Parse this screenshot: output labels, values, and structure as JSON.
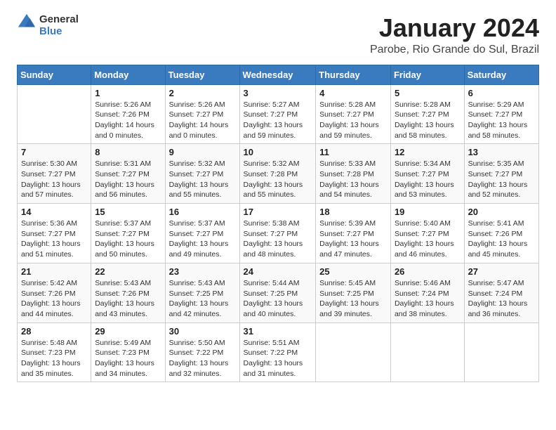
{
  "header": {
    "logo_general": "General",
    "logo_blue": "Blue",
    "main_title": "January 2024",
    "subtitle": "Parobe, Rio Grande do Sul, Brazil"
  },
  "days_of_week": [
    "Sunday",
    "Monday",
    "Tuesday",
    "Wednesday",
    "Thursday",
    "Friday",
    "Saturday"
  ],
  "weeks": [
    [
      {
        "day": "",
        "sunrise": "",
        "sunset": "",
        "daylight": ""
      },
      {
        "day": "1",
        "sunrise": "5:26 AM",
        "sunset": "7:26 PM",
        "daylight": "14 hours and 0 minutes."
      },
      {
        "day": "2",
        "sunrise": "5:26 AM",
        "sunset": "7:27 PM",
        "daylight": "14 hours and 0 minutes."
      },
      {
        "day": "3",
        "sunrise": "5:27 AM",
        "sunset": "7:27 PM",
        "daylight": "13 hours and 59 minutes."
      },
      {
        "day": "4",
        "sunrise": "5:28 AM",
        "sunset": "7:27 PM",
        "daylight": "13 hours and 59 minutes."
      },
      {
        "day": "5",
        "sunrise": "5:28 AM",
        "sunset": "7:27 PM",
        "daylight": "13 hours and 58 minutes."
      },
      {
        "day": "6",
        "sunrise": "5:29 AM",
        "sunset": "7:27 PM",
        "daylight": "13 hours and 58 minutes."
      }
    ],
    [
      {
        "day": "7",
        "sunrise": "5:30 AM",
        "sunset": "7:27 PM",
        "daylight": "13 hours and 57 minutes."
      },
      {
        "day": "8",
        "sunrise": "5:31 AM",
        "sunset": "7:27 PM",
        "daylight": "13 hours and 56 minutes."
      },
      {
        "day": "9",
        "sunrise": "5:32 AM",
        "sunset": "7:27 PM",
        "daylight": "13 hours and 55 minutes."
      },
      {
        "day": "10",
        "sunrise": "5:32 AM",
        "sunset": "7:28 PM",
        "daylight": "13 hours and 55 minutes."
      },
      {
        "day": "11",
        "sunrise": "5:33 AM",
        "sunset": "7:28 PM",
        "daylight": "13 hours and 54 minutes."
      },
      {
        "day": "12",
        "sunrise": "5:34 AM",
        "sunset": "7:27 PM",
        "daylight": "13 hours and 53 minutes."
      },
      {
        "day": "13",
        "sunrise": "5:35 AM",
        "sunset": "7:27 PM",
        "daylight": "13 hours and 52 minutes."
      }
    ],
    [
      {
        "day": "14",
        "sunrise": "5:36 AM",
        "sunset": "7:27 PM",
        "daylight": "13 hours and 51 minutes."
      },
      {
        "day": "15",
        "sunrise": "5:37 AM",
        "sunset": "7:27 PM",
        "daylight": "13 hours and 50 minutes."
      },
      {
        "day": "16",
        "sunrise": "5:37 AM",
        "sunset": "7:27 PM",
        "daylight": "13 hours and 49 minutes."
      },
      {
        "day": "17",
        "sunrise": "5:38 AM",
        "sunset": "7:27 PM",
        "daylight": "13 hours and 48 minutes."
      },
      {
        "day": "18",
        "sunrise": "5:39 AM",
        "sunset": "7:27 PM",
        "daylight": "13 hours and 47 minutes."
      },
      {
        "day": "19",
        "sunrise": "5:40 AM",
        "sunset": "7:27 PM",
        "daylight": "13 hours and 46 minutes."
      },
      {
        "day": "20",
        "sunrise": "5:41 AM",
        "sunset": "7:26 PM",
        "daylight": "13 hours and 45 minutes."
      }
    ],
    [
      {
        "day": "21",
        "sunrise": "5:42 AM",
        "sunset": "7:26 PM",
        "daylight": "13 hours and 44 minutes."
      },
      {
        "day": "22",
        "sunrise": "5:43 AM",
        "sunset": "7:26 PM",
        "daylight": "13 hours and 43 minutes."
      },
      {
        "day": "23",
        "sunrise": "5:43 AM",
        "sunset": "7:25 PM",
        "daylight": "13 hours and 42 minutes."
      },
      {
        "day": "24",
        "sunrise": "5:44 AM",
        "sunset": "7:25 PM",
        "daylight": "13 hours and 40 minutes."
      },
      {
        "day": "25",
        "sunrise": "5:45 AM",
        "sunset": "7:25 PM",
        "daylight": "13 hours and 39 minutes."
      },
      {
        "day": "26",
        "sunrise": "5:46 AM",
        "sunset": "7:24 PM",
        "daylight": "13 hours and 38 minutes."
      },
      {
        "day": "27",
        "sunrise": "5:47 AM",
        "sunset": "7:24 PM",
        "daylight": "13 hours and 36 minutes."
      }
    ],
    [
      {
        "day": "28",
        "sunrise": "5:48 AM",
        "sunset": "7:23 PM",
        "daylight": "13 hours and 35 minutes."
      },
      {
        "day": "29",
        "sunrise": "5:49 AM",
        "sunset": "7:23 PM",
        "daylight": "13 hours and 34 minutes."
      },
      {
        "day": "30",
        "sunrise": "5:50 AM",
        "sunset": "7:22 PM",
        "daylight": "13 hours and 32 minutes."
      },
      {
        "day": "31",
        "sunrise": "5:51 AM",
        "sunset": "7:22 PM",
        "daylight": "13 hours and 31 minutes."
      },
      {
        "day": "",
        "sunrise": "",
        "sunset": "",
        "daylight": ""
      },
      {
        "day": "",
        "sunrise": "",
        "sunset": "",
        "daylight": ""
      },
      {
        "day": "",
        "sunrise": "",
        "sunset": "",
        "daylight": ""
      }
    ]
  ],
  "labels": {
    "sunrise": "Sunrise:",
    "sunset": "Sunset:",
    "daylight": "Daylight hours"
  }
}
